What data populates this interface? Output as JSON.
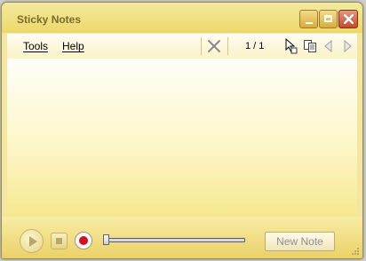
{
  "window": {
    "title": "Sticky Notes"
  },
  "titlebar_buttons": {
    "minimize": "minimize-icon",
    "maximize": "maximize-icon",
    "close": "close-icon"
  },
  "menubar": {
    "tools_label": "Tools",
    "help_label": "Help",
    "page_indicator": "1 / 1",
    "icons": [
      "delete-note-icon",
      "cursor-note-icon",
      "copy-note-icon",
      "previous-note-icon",
      "next-note-icon"
    ]
  },
  "player": {
    "icons": [
      "play-icon",
      "stop-icon",
      "record-icon"
    ],
    "playback_position": 0
  },
  "new_note_label": "New Note",
  "colors": {
    "accent": "#ecd869",
    "note_background": "#fdf5c4",
    "record": "#d4101e",
    "close_button": "#c64a28"
  }
}
